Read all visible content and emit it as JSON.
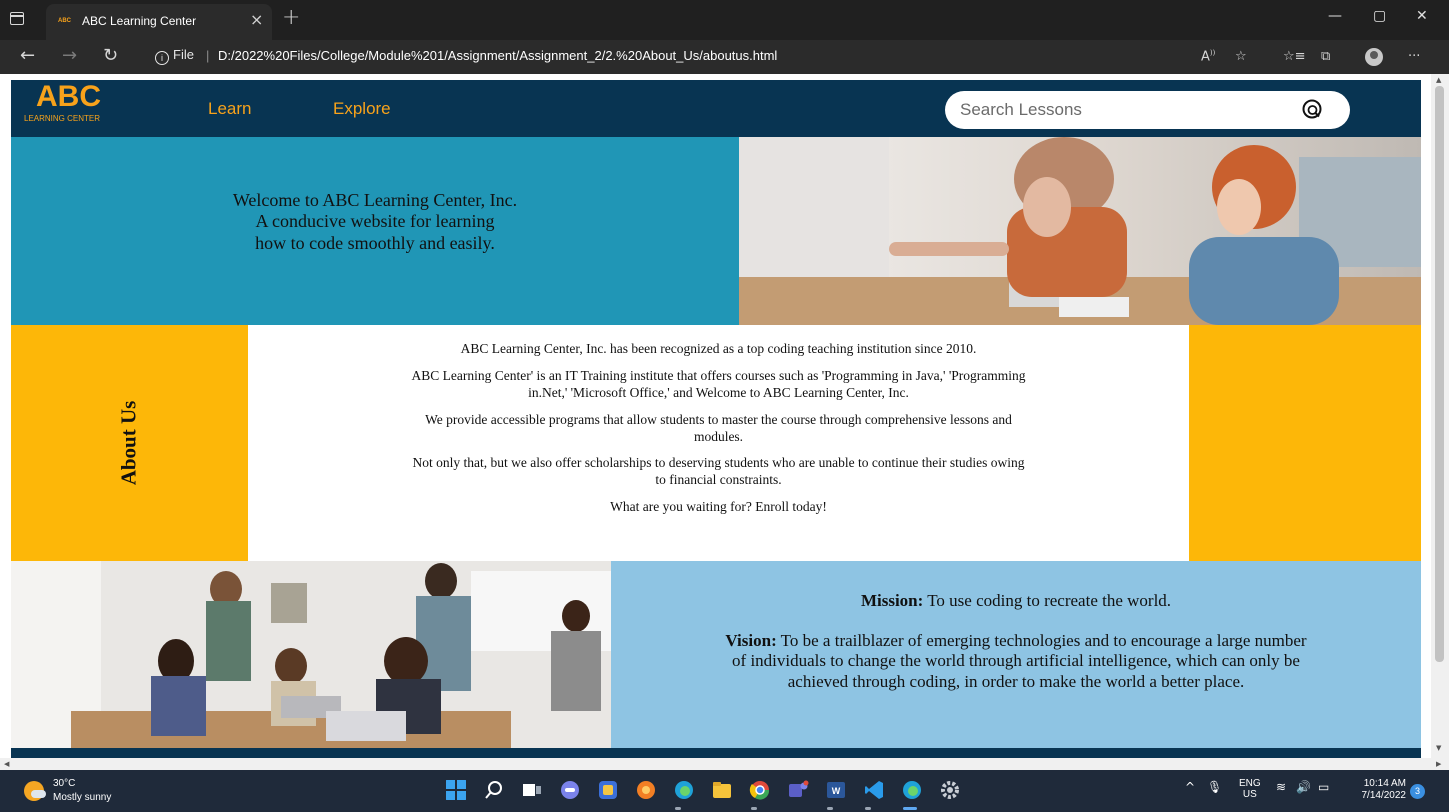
{
  "browser": {
    "tab_title": "ABC Learning Center",
    "tab_favicon_text": "ABC",
    "tab_close": "×",
    "new_tab": "+",
    "url_label": "File",
    "url": "D:/2022%20Files/College/Module%201/Assignment/Assignment_2/2.%20About_Us/aboutus.html"
  },
  "site": {
    "logo_main": "ABC",
    "logo_sub": "LEARNING CENTER",
    "nav": [
      "Learn",
      "Explore"
    ],
    "search_placeholder": "Search Lessons",
    "hero_lines": [
      "Welcome to ABC Learning Center, Inc.",
      "A conducive website for learning",
      "how to code smoothly and easily."
    ],
    "about_title": "About Us",
    "about_paragraphs": [
      "ABC Learning Center, Inc. has been recognized as a top coding teaching institution since 2010.",
      "ABC Learning Center' is an IT Training institute that offers courses such as 'Programming in Java,' 'Programming in.Net,' 'Microsoft Office,' and Welcome to ABC Learning Center, Inc.",
      "We provide accessible programs that allow students to master the course through comprehensive lessons and modules.",
      "Not only that, but we also offer scholarships to deserving students who are unable to continue their studies owing to financial constraints.",
      "What are you waiting for? Enroll today!"
    ],
    "mission_label": "Mission:",
    "mission_text": " To use coding to recreate the world.",
    "vision_label": "Vision:",
    "vision_text": " To be a trailblazer of emerging technologies and to encourage a large number of individuals to change the world through artificial intelligence, which can only be achieved through coding, in order to make the world a better place."
  },
  "taskbar": {
    "temperature": "30°C",
    "weather": "Mostly sunny",
    "lang_top": "ENG",
    "lang_bottom": "US",
    "time": "10:14 AM",
    "date": "7/14/2022",
    "notifications": "3"
  },
  "colors": {
    "navy": "#083452",
    "orange": "#f7a21b",
    "teal": "#2096b6",
    "yellow": "#fdb708",
    "light_blue": "#8ec4e3"
  }
}
